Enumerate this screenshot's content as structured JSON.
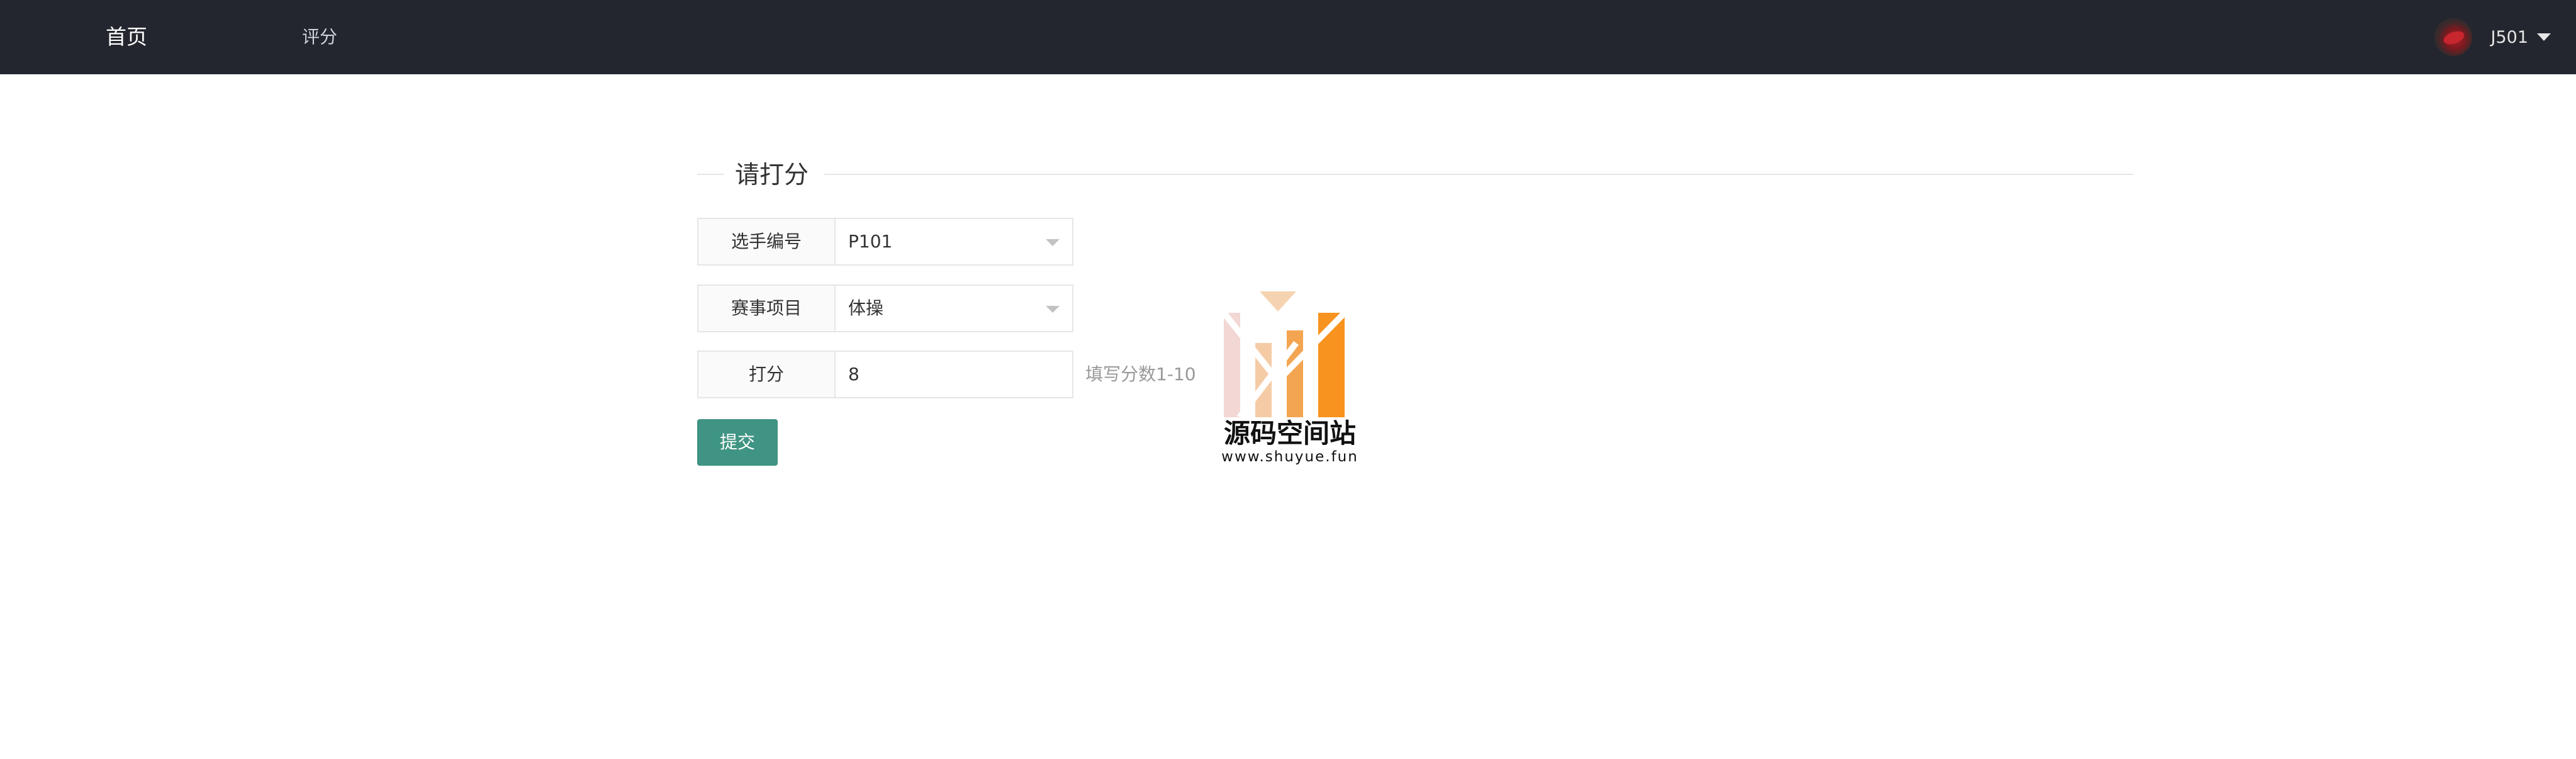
{
  "nav": {
    "home_label": "首页",
    "score_label": "评分",
    "user_name": "J501"
  },
  "form": {
    "legend": "请打分",
    "fields": [
      {
        "label": "选手编号",
        "value": "P101",
        "type": "select"
      },
      {
        "label": "赛事项目",
        "value": "体操",
        "type": "select"
      },
      {
        "label": "打分",
        "value": "8",
        "type": "input",
        "hint": "填写分数1-10"
      }
    ],
    "submit_label": "提交"
  },
  "watermark": {
    "name": "源码空间站",
    "url": "www.shuyue.fun"
  },
  "colors": {
    "topbar_bg": "#23262e",
    "submit_bg": "#3f9483",
    "logo_orange": "#f7931e",
    "logo_pink": "#f2c6c6"
  }
}
